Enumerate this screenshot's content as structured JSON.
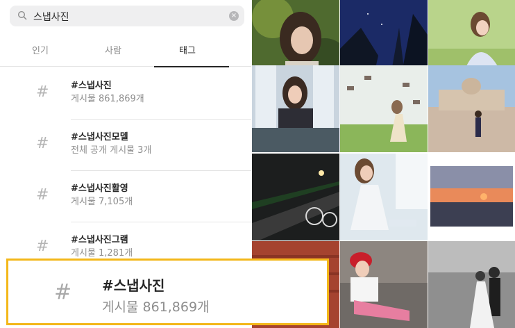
{
  "search": {
    "query": "스냅사진",
    "clear_icon": "clear-icon"
  },
  "tabs": [
    {
      "label": "인기",
      "active": false
    },
    {
      "label": "사람",
      "active": false
    },
    {
      "label": "태그",
      "active": true
    }
  ],
  "results": [
    {
      "hash": "#",
      "name": "#스냅사진",
      "count": "게시물 861,869개"
    },
    {
      "hash": "#",
      "name": "#스냅사진모델",
      "count": "전체 공개 게시물 3개"
    },
    {
      "hash": "#",
      "name": "#스냅사진활영",
      "count": "게시물 7,105개"
    },
    {
      "hash": "#",
      "name": "#스냅사진그램",
      "count": "게시물 1,281개"
    }
  ],
  "highlight": {
    "hash": "#",
    "name": "#스냅사진",
    "count": "게시물 861,869개",
    "border_color": "#f3b719"
  },
  "photos": [
    "woman-forest-portrait",
    "night-sky-trees",
    "woman-sitting-grass",
    "woman-by-window",
    "woman-field-kites",
    "woman-plaza-cathedral",
    "night-road-bicycle",
    "woman-seated-window",
    "sunset-sea",
    "red-brick-wall",
    "woman-red-beret",
    "wedding-couple-bw"
  ]
}
